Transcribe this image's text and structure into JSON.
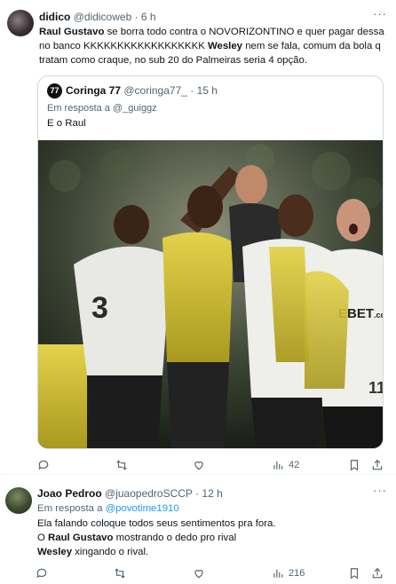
{
  "tweet1": {
    "name": "didico",
    "handle": "@didicoweb",
    "time": "· 6 h",
    "text_parts": [
      {
        "t": "Raul Gustavo",
        "b": true
      },
      {
        "t": " se borra todo contra o NOVORIZONTINO e quer pagar dessa no banco KKKKKKKKKKKKKKKKKK ",
        "b": false
      },
      {
        "t": "Wesley",
        "b": true
      },
      {
        "t": " nem se fala, comum da bola q tratam como craque, no sub 20 do Palmeiras seria 4 opção.",
        "b": false
      }
    ],
    "quote": {
      "logo_text": "77",
      "name": "Coringa 77",
      "handle": "@coringa77_",
      "time": "· 15 h",
      "reply_to": "Em resposta a @_guiggz",
      "text": "E o Raul"
    },
    "actions": {
      "reply": "",
      "retweet": "",
      "like": "",
      "views": "42"
    }
  },
  "tweet2": {
    "name": "Joao Pedroo",
    "handle": "@juaopedroSCCP",
    "time": "· 12 h",
    "reply_prefix": "Em resposta a ",
    "reply_handle": "@povotime1910",
    "line1": "Ela falando coloque todos seus sentimentos pra fora.",
    "line2_a": "O ",
    "line2_b": "Raul Gustavo",
    "line2_c": " mostrando o dedo pro rival",
    "line3_a": "Wesley",
    "line3_b": " xingando o rival.",
    "actions": {
      "reply": "",
      "retweet": "",
      "like": "",
      "views": "216"
    }
  },
  "photo_texts": {
    "number_left": "3",
    "number_right": "11",
    "sponsor": "EBET",
    "sponsor_suffix": ".com"
  },
  "colors": {
    "link": "#1d9bf0",
    "secondary": "#536471",
    "text": "#0f1419",
    "border": "#cfd9de"
  }
}
